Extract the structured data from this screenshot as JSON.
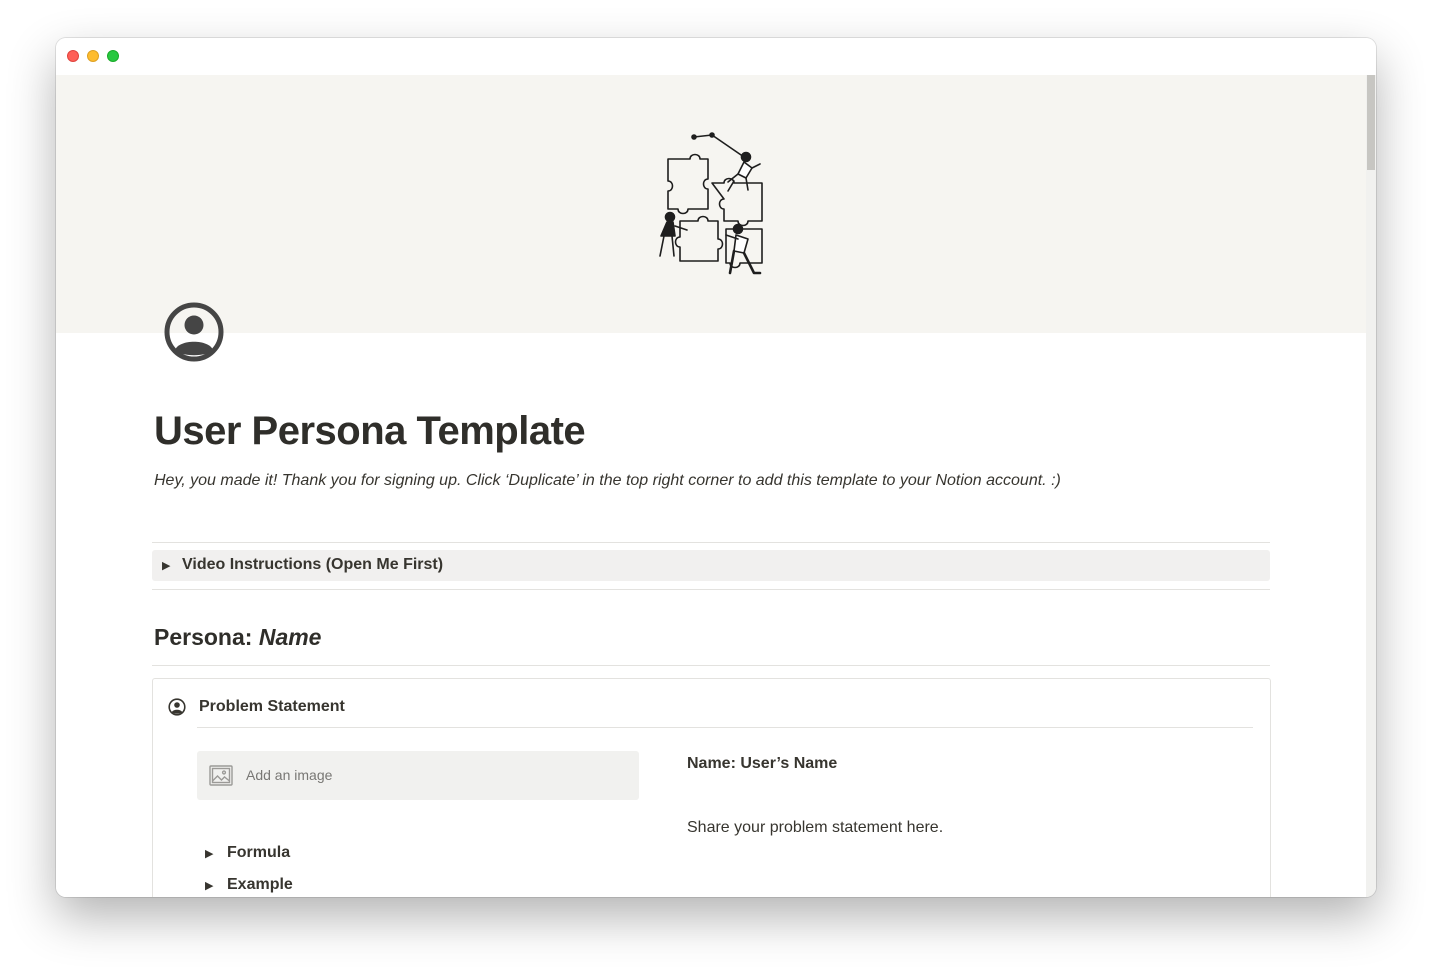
{
  "page": {
    "title": "User Persona Template",
    "subtitle": "Hey, you made it! Thank you for signing up. Click ‘Duplicate’ in the top right corner to add this template to your Notion account. :)",
    "icon": "user-circle-icon",
    "cover": "puzzle-team-illustration"
  },
  "toggles": {
    "video": {
      "label": "Video Instructions (Open Me First)",
      "icon": "triangle-right-icon"
    }
  },
  "persona": {
    "heading_prefix": "Persona: ",
    "heading_name": "Name"
  },
  "card": {
    "icon": "user-circle-icon",
    "title": "Problem Statement",
    "add_image_label": "Add an image",
    "add_image_icon": "image-icon",
    "formula_label": "Formula",
    "example_label": "Example",
    "name_line": "Name: User’s Name",
    "problem_text": "Share your problem statement here."
  },
  "colors": {
    "cover_bg": "#f6f5f1",
    "text": "#37352f",
    "toggle_bg": "#f1f0ef",
    "divider": "#e3e2df"
  }
}
